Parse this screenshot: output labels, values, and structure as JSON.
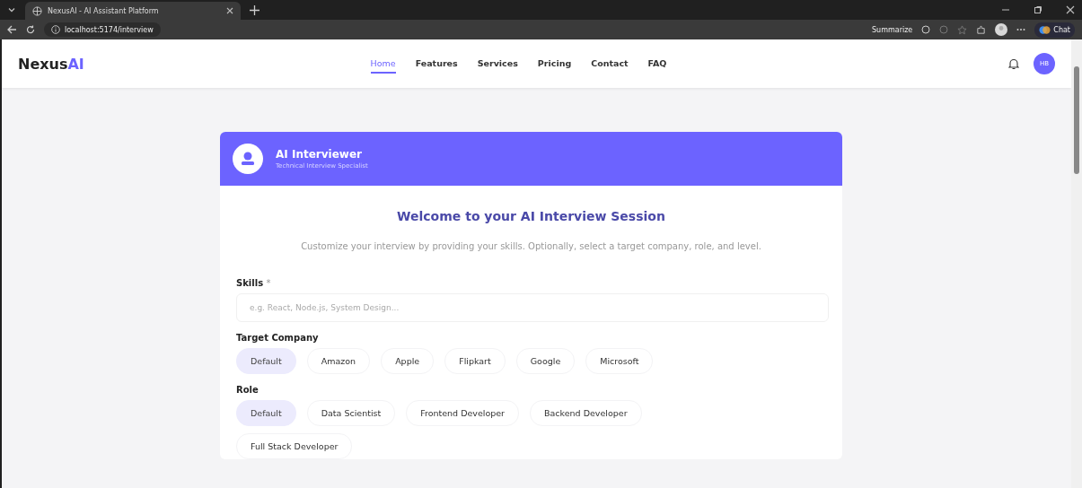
{
  "browser": {
    "tab_title": "NexusAI - AI Assistant Platform",
    "url": "localhost:5174/interview",
    "toolbar": {
      "summarize": "Summarize",
      "chat": "Chat"
    }
  },
  "nav": {
    "logo": {
      "prefix": "Nexus",
      "accent": "AI"
    },
    "links": [
      {
        "label": "Home",
        "selected": true
      },
      {
        "label": "Features",
        "selected": false
      },
      {
        "label": "Services",
        "selected": false
      },
      {
        "label": "Pricing",
        "selected": false
      },
      {
        "label": "Contact",
        "selected": false
      },
      {
        "label": "FAQ",
        "selected": false
      }
    ],
    "avatar": "HB"
  },
  "card": {
    "header": {
      "title": "AI Interviewer",
      "subtitle": "Technical Interview Specialist"
    },
    "heading": "Welcome to your AI Interview Session",
    "intro": "Customize your interview by providing your skills. Optionally, select a target company, role, and level.",
    "skills": {
      "label": "Skills",
      "required_mark": "*",
      "placeholder": "e.g. React, Node.js, System Design..."
    },
    "groups": [
      {
        "label": "Target Company",
        "options": [
          {
            "label": "Default",
            "selected": true
          },
          {
            "label": "Amazon",
            "selected": false
          },
          {
            "label": "Apple",
            "selected": false
          },
          {
            "label": "Flipkart",
            "selected": false
          },
          {
            "label": "Google",
            "selected": false
          },
          {
            "label": "Microsoft",
            "selected": false
          }
        ]
      },
      {
        "label": "Role",
        "options": [
          {
            "label": "Default",
            "selected": true
          },
          {
            "label": "Data Scientist",
            "selected": false
          },
          {
            "label": "Frontend Developer",
            "selected": false
          },
          {
            "label": "Backend Developer",
            "selected": false
          },
          {
            "label": "Full Stack Developer",
            "selected": false
          }
        ]
      }
    ]
  }
}
